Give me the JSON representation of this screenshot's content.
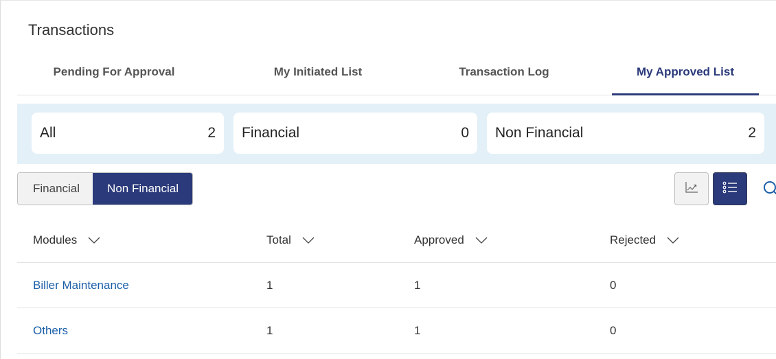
{
  "page": {
    "title": "Transactions"
  },
  "tabs": [
    {
      "label": "Pending For Approval",
      "active": false
    },
    {
      "label": "My Initiated List",
      "active": false
    },
    {
      "label": "Transaction Log",
      "active": false
    },
    {
      "label": "My Approved List",
      "active": true
    }
  ],
  "summary_cards": [
    {
      "label": "All",
      "count": "2"
    },
    {
      "label": "Financial",
      "count": "0"
    },
    {
      "label": "Non Financial",
      "count": "2"
    }
  ],
  "type_toggle": {
    "options": [
      "Financial",
      "Non Financial"
    ],
    "selected": "Non Financial"
  },
  "view_controls": {
    "chart_icon": "line-chart-icon",
    "list_icon": "list-icon",
    "active": "list",
    "search_icon": "search-icon"
  },
  "table": {
    "columns": [
      "Modules",
      "Total",
      "Approved",
      "Rejected"
    ],
    "rows": [
      {
        "module": "Biller Maintenance",
        "total": "1",
        "approved": "1",
        "rejected": "0"
      },
      {
        "module": "Others",
        "total": "1",
        "approved": "1",
        "rejected": "0"
      }
    ]
  },
  "colors": {
    "primary": "#2b3a7a",
    "link": "#1a5fa8",
    "summary_bg": "#e3f0f7"
  }
}
